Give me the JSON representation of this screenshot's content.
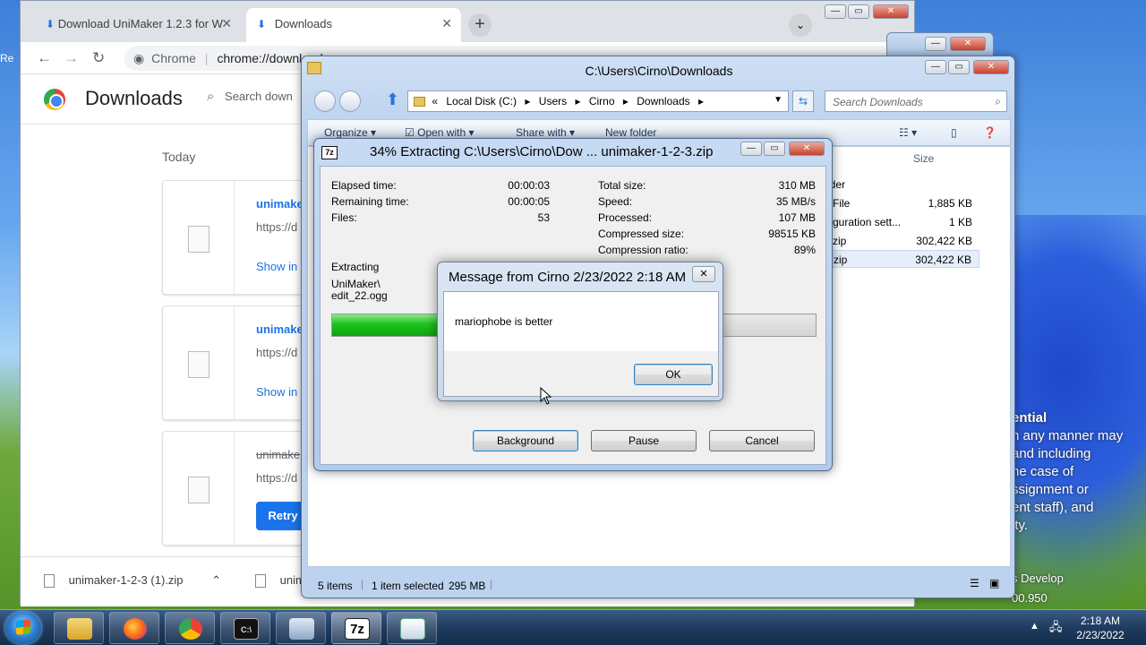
{
  "desktop": {
    "partial_text": [
      "ential",
      "n any manner may",
      "and including",
      "he case of",
      "ssignment or",
      "ent staff), and",
      "ity.",
      "s Develop",
      "00.950"
    ],
    "left_clip": "Re"
  },
  "chrome": {
    "tabs": [
      {
        "label": "Download UniMaker 1.2.3 for W"
      },
      {
        "label": "Downloads"
      }
    ],
    "new_tab_glyph": "+",
    "tab_close_glyph": "✕",
    "omnibox": {
      "site": "Chrome",
      "url": "chrome://downloads"
    },
    "page_title": "Downloads",
    "search_placeholder": "Search down",
    "section_label": "Today",
    "items": [
      {
        "name": "unimake",
        "url": "https://d",
        "action": "Show in"
      },
      {
        "name": "unimake",
        "url": "https://d",
        "action": "Show in"
      },
      {
        "name": "unimake",
        "url": "https://d",
        "action": "Retry"
      }
    ],
    "shelf": [
      {
        "name": "unimaker-1-2-3 (1).zip"
      },
      {
        "name": "unim"
      }
    ]
  },
  "explorer": {
    "title": "C:\\Users\\Cirno\\Downloads",
    "address": [
      "«",
      "Local Disk (C:)",
      "Users",
      "Cirno",
      "Downloads"
    ],
    "search_placeholder": "Search Downloads",
    "toolbar": {
      "organize": "Organize",
      "open_with": "Open with",
      "share_with": "Share with",
      "new_folder": "New folder"
    },
    "column_size": "Size",
    "rows": [
      {
        "type": "lder",
        "size": ""
      },
      {
        "type": "File",
        "size": "1,885 KB"
      },
      {
        "type": "guration sett...",
        "size": "1 KB"
      },
      {
        "type": "zip",
        "size": "302,422 KB"
      },
      {
        "type": "zip",
        "size": "302,422 KB"
      }
    ],
    "status": {
      "items": "5 items",
      "selected": "1 item selected",
      "size": "295 MB"
    }
  },
  "zip_progress": {
    "title": "34% Extracting C:\\Users\\Cirno\\Dow ... unimaker-1-2-3.zip",
    "app_icon": "7z",
    "left_stats": [
      {
        "label": "Elapsed time:",
        "value": "00:00:03"
      },
      {
        "label": "Remaining time:",
        "value": "00:00:05"
      },
      {
        "label": "Files:",
        "value": "53"
      }
    ],
    "right_stats": [
      {
        "label": "Total size:",
        "value": "310 MB"
      },
      {
        "label": "Speed:",
        "value": "35 MB/s"
      },
      {
        "label": "Processed:",
        "value": "107 MB"
      },
      {
        "label": "Compressed size:",
        "value": "98515 KB"
      },
      {
        "label": "Compression ratio:",
        "value": "89%"
      }
    ],
    "action_label": "Extracting",
    "current_path": "UniMaker\\",
    "current_file": "edit_22.ogg",
    "progress_fraction": 0.34,
    "buttons": {
      "background": "Background",
      "pause": "Pause",
      "cancel": "Cancel"
    }
  },
  "message_box": {
    "title": "Message from Cirno 2/23/2022 2:18 AM",
    "text": "mariophobe is better",
    "ok": "OK",
    "close_glyph": "✕"
  },
  "taskbar": {
    "cmd_label": "C:\\",
    "zip_label": "7z",
    "time": "2:18 AM",
    "date": "2/23/2022"
  }
}
